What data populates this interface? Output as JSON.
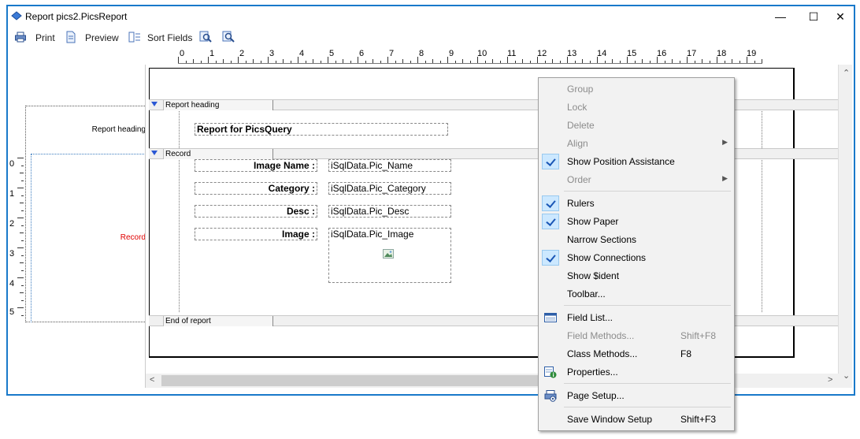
{
  "window": {
    "title": "Report pics2.PicsReport",
    "minimize": "—",
    "maximize": "☐",
    "close": "✕"
  },
  "toolbar": {
    "print": "Print",
    "preview": "Preview",
    "sort_fields": "Sort Fields"
  },
  "ruler": {
    "h_numbers": [
      "0",
      "1",
      "2",
      "3",
      "4",
      "5",
      "6",
      "7",
      "8",
      "9",
      "10",
      "11",
      "12",
      "13",
      "14",
      "15",
      "16",
      "17",
      "18",
      "19"
    ],
    "v_numbers": [
      "0",
      "1",
      "2",
      "3",
      "4",
      "5"
    ]
  },
  "sections": {
    "report_heading": "Report heading",
    "record": "Record",
    "end_of_report": "End of report"
  },
  "side_labels": {
    "report_heading": "Report heading",
    "record": "Record"
  },
  "fields": {
    "title": "Report for PicsQuery",
    "image_name_label": "Image Name :",
    "image_name_value": "iSqlData.Pic_Name",
    "category_label": "Category :",
    "category_value": "iSqlData.Pic_Category",
    "desc_label": "Desc :",
    "desc_value": "iSqlData.Pic_Desc",
    "image_label": "Image :",
    "image_value": "iSqlData.Pic_Image"
  },
  "menu": {
    "group": "Group",
    "lock": "Lock",
    "delete": "Delete",
    "align": "Align",
    "show_position_assistance": "Show Position Assistance",
    "order": "Order",
    "rulers": "Rulers",
    "show_paper": "Show Paper",
    "narrow_sections": "Narrow Sections",
    "show_connections": "Show Connections",
    "show_ident": "Show $ident",
    "toolbar": "Toolbar...",
    "field_list": "Field List...",
    "field_methods": "Field Methods...",
    "field_methods_shortcut": "Shift+F8",
    "class_methods": "Class Methods...",
    "class_methods_shortcut": "F8",
    "properties": "Properties...",
    "page_setup": "Page Setup...",
    "save_window_setup": "Save Window Setup",
    "save_window_setup_shortcut": "Shift+F3"
  },
  "colors": {
    "window_border": "#1979ca",
    "record_label": "#e00000",
    "check_bg": "#cce8ff"
  }
}
